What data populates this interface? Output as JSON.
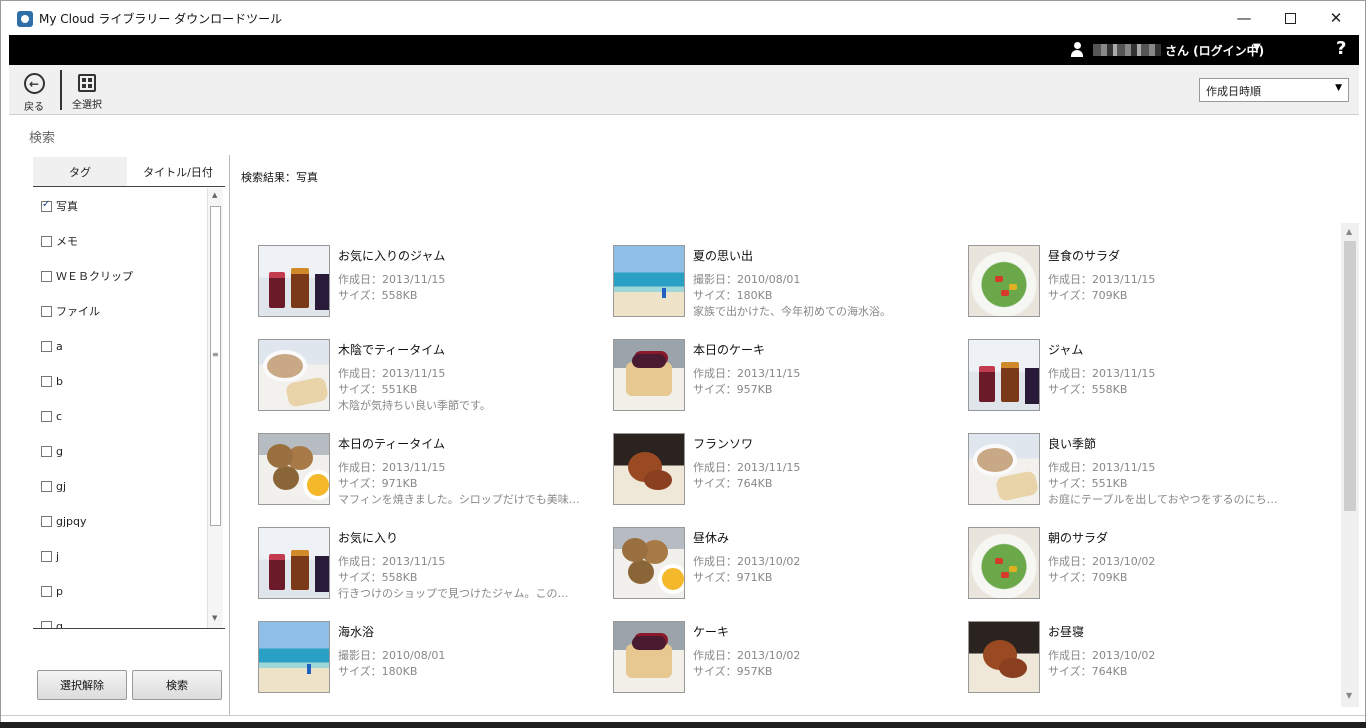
{
  "window": {
    "title": "My Cloud ライブラリー ダウンロードツール",
    "minimize": "—",
    "close": "✕"
  },
  "account": {
    "name_suffix": "さん (ログイン中)",
    "dropdown": "▼",
    "help": "?"
  },
  "toolbar": {
    "back_label": "戻る",
    "back_glyph": "←",
    "select_all_label": "全選択",
    "sort": {
      "selected": "作成日時順",
      "arrow": "▼"
    }
  },
  "search": {
    "title": "検索",
    "tabs": [
      "タグ",
      "タイトル/日付"
    ],
    "tags": [
      {
        "label": "写真",
        "checked": true
      },
      {
        "label": "メモ",
        "checked": false
      },
      {
        "label": "ＷＥＢクリップ",
        "checked": false
      },
      {
        "label": "ファイル",
        "checked": false
      },
      {
        "label": "a",
        "checked": false
      },
      {
        "label": "b",
        "checked": false
      },
      {
        "label": "c",
        "checked": false
      },
      {
        "label": "g",
        "checked": false
      },
      {
        "label": "gj",
        "checked": false
      },
      {
        "label": "gjpqy",
        "checked": false
      },
      {
        "label": "j",
        "checked": false
      },
      {
        "label": "p",
        "checked": false
      },
      {
        "label": "q",
        "checked": false
      }
    ],
    "clear_button": "選択解除",
    "search_button": "検索",
    "scroll_up": "▲",
    "scroll_down": "▼",
    "scroll_grip": "≡"
  },
  "results": {
    "heading": "検索結果：写真",
    "items": [
      {
        "title": "お気に入りのジャム",
        "lines": [
          "作成日：2013/11/15",
          "サイズ：558KB"
        ],
        "image": "jam"
      },
      {
        "title": "夏の思い出",
        "lines": [
          "撮影日：2010/08/01",
          "サイズ：180KB",
          "家族で出かけた、今年初めての海水浴。"
        ],
        "image": "beach"
      },
      {
        "title": "昼食のサラダ",
        "lines": [
          "作成日：2013/11/15",
          "サイズ：709KB"
        ],
        "image": "salad"
      },
      {
        "title": "木陰でティータイム",
        "lines": [
          "作成日：2013/11/15",
          "サイズ：551KB",
          "木陰が気持ちい良い季節です。"
        ],
        "image": "tea"
      },
      {
        "title": "本日のケーキ",
        "lines": [
          "作成日：2013/11/15",
          "サイズ：957KB"
        ],
        "image": "cake"
      },
      {
        "title": "ジャム",
        "lines": [
          "作成日：2013/11/15",
          "サイズ：558KB"
        ],
        "image": "jam"
      },
      {
        "title": "本日のティータイム",
        "lines": [
          "作成日：2013/11/15",
          "サイズ：971KB",
          "マフィンを焼きました。シロップだけでも美味…"
        ],
        "image": "scone"
      },
      {
        "title": "フランソワ",
        "lines": [
          "作成日：2013/11/15",
          "サイズ：764KB"
        ],
        "image": "bear"
      },
      {
        "title": "良い季節",
        "lines": [
          "作成日：2013/11/15",
          "サイズ：551KB",
          "お庭にテーブルを出しておやつをするのにち…"
        ],
        "image": "tea"
      },
      {
        "title": "お気に入り",
        "lines": [
          "作成日：2013/11/15",
          "サイズ：558KB",
          "行きつけのショップで見つけたジャム。この…"
        ],
        "image": "jam"
      },
      {
        "title": "昼休み",
        "lines": [
          "作成日：2013/10/02",
          "サイズ：971KB"
        ],
        "image": "scone"
      },
      {
        "title": "朝のサラダ",
        "lines": [
          "作成日：2013/10/02",
          "サイズ：709KB"
        ],
        "image": "salad"
      },
      {
        "title": "海水浴",
        "lines": [
          "撮影日：2010/08/01",
          "サイズ：180KB"
        ],
        "image": "beach"
      },
      {
        "title": "ケーキ",
        "lines": [
          "作成日：2013/10/02",
          "サイズ：957KB"
        ],
        "image": "cake"
      },
      {
        "title": "お昼寝",
        "lines": [
          "作成日：2013/10/02",
          "サイズ：764KB"
        ],
        "image": "bear"
      }
    ]
  }
}
